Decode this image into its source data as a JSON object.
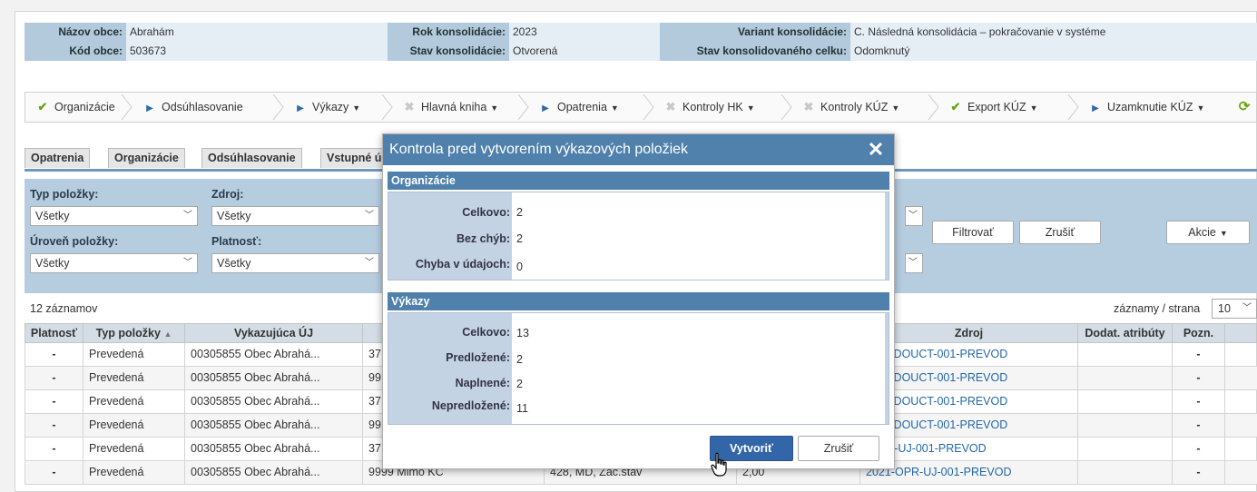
{
  "info": {
    "nazov_obce_label": "Názov obce:",
    "nazov_obce": "Abrahám",
    "kod_obce_label": "Kód obce:",
    "kod_obce": "503673",
    "rok_label": "Rok konsolidácie:",
    "rok": "2023",
    "stav_label": "Stav konsolidácie:",
    "stav": "Otvorená",
    "variant_label": "Variant konsolidácie:",
    "variant": "C. Následná konsolidácia – pokračovanie v systéme",
    "stav_celku_label": "Stav konsolidovaného celku:",
    "stav_celku": "Odomknutý"
  },
  "steps": [
    {
      "label": "Organizácie",
      "icon": "check-icon"
    },
    {
      "label": "Odsúhlasovanie",
      "icon": "arrow-right-icon"
    },
    {
      "label": "Výkazy",
      "icon": "arrow-right-icon"
    },
    {
      "label": "Hlavná kniha",
      "icon": "x-icon"
    },
    {
      "label": "Opatrenia",
      "icon": "arrow-right-icon"
    },
    {
      "label": "Kontroly HK",
      "icon": "x-icon"
    },
    {
      "label": "Kontroly KÚZ",
      "icon": "x-icon"
    },
    {
      "label": "Export KÚZ",
      "icon": "check-icon"
    },
    {
      "label": "Uzamknutie KÚZ",
      "icon": "arrow-right-icon"
    }
  ],
  "tabs": [
    "Opatrenia",
    "Organizácie",
    "Odsúhlasovanie",
    "Vstupné úd"
  ],
  "filters": {
    "typ_label": "Typ položky:",
    "typ_value": "Všetky",
    "zdroj_label": "Zdroj:",
    "zdroj_value": "Všetky",
    "uroven_label": "Úroveň položky:",
    "uroven_value": "Všetky",
    "platnost_label": "Platnosť:",
    "platnost_value": "Všetky",
    "filter_btn": "Filtrovať",
    "reset_btn": "Zrušiť",
    "actions_btn": "Akcie"
  },
  "list": {
    "count": "12 záznamov",
    "per_page_label": "záznamy / strana",
    "per_page_value": "10"
  },
  "table": {
    "headers": {
      "platnost": "Platnosť",
      "typ": "Typ položky",
      "uj": "Vykazujúca ÚJ",
      "zdroj": "Zdroj",
      "dodat": "Dodat. atribúty",
      "pozn": "Pozn."
    },
    "rows": [
      {
        "platnost": "-",
        "typ": "Prevedená",
        "uj": "00305855 Obec Abrahá...",
        "partner": "37",
        "ucet": "",
        "suma": "",
        "zdroj": "HNE-DOUCT-001-PREVOD",
        "pozn": "-"
      },
      {
        "platnost": "-",
        "typ": "Prevedená",
        "uj": "00305855 Obec Abrahá...",
        "partner": "99",
        "ucet": "",
        "suma": "",
        "zdroj": "HNE-DOUCT-001-PREVOD",
        "pozn": "-"
      },
      {
        "platnost": "-",
        "typ": "Prevedená",
        "uj": "00305855 Obec Abrahá...",
        "partner": "37",
        "ucet": "",
        "suma": "",
        "zdroj": "HNE-DOUCT-001-PREVOD",
        "pozn": "-"
      },
      {
        "platnost": "-",
        "typ": "Prevedená",
        "uj": "00305855 Obec Abrahá...",
        "partner": "99",
        "ucet": "",
        "suma": "",
        "zdroj": "HNE-DOUCT-001-PREVOD",
        "pozn": "-"
      },
      {
        "platnost": "-",
        "typ": "Prevedená",
        "uj": "00305855 Obec Abrahá...",
        "partner": "37",
        "ucet": "",
        "suma": "",
        "zdroj": "-OPR-UJ-001-PREVOD",
        "pozn": "-"
      },
      {
        "platnost": "-",
        "typ": "Prevedená",
        "uj": "00305855 Obec Abrahá...",
        "partner": "9999 Mimo KC",
        "ucet": "428, MD, Zač.stav",
        "suma": "2,00",
        "zdroj": "2021-OPR-UJ-001-PREVOD",
        "pozn": "-"
      }
    ]
  },
  "dialog": {
    "title": "Kontrola pred vytvorením výkazových položiek",
    "org_section": "Organizácie",
    "org_celkovo_label": "Celkovo:",
    "org_celkovo": "2",
    "org_bez_label": "Bez chýb:",
    "org_bez": "2",
    "org_chyba_label": "Chyba v údajoch:",
    "org_chyba": "0",
    "vyk_section": "Výkazy",
    "vyk_celkovo_label": "Celkovo:",
    "vyk_celkovo": "13",
    "vyk_pred_label": "Predložené:",
    "vyk_pred": "2",
    "vyk_napl_label": "Naplnené:",
    "vyk_napl": "2",
    "vyk_nepred_label": "Nepredložené:",
    "vyk_nepred": "11",
    "create_btn": "Vytvoriť",
    "cancel_btn": "Zrušiť"
  }
}
